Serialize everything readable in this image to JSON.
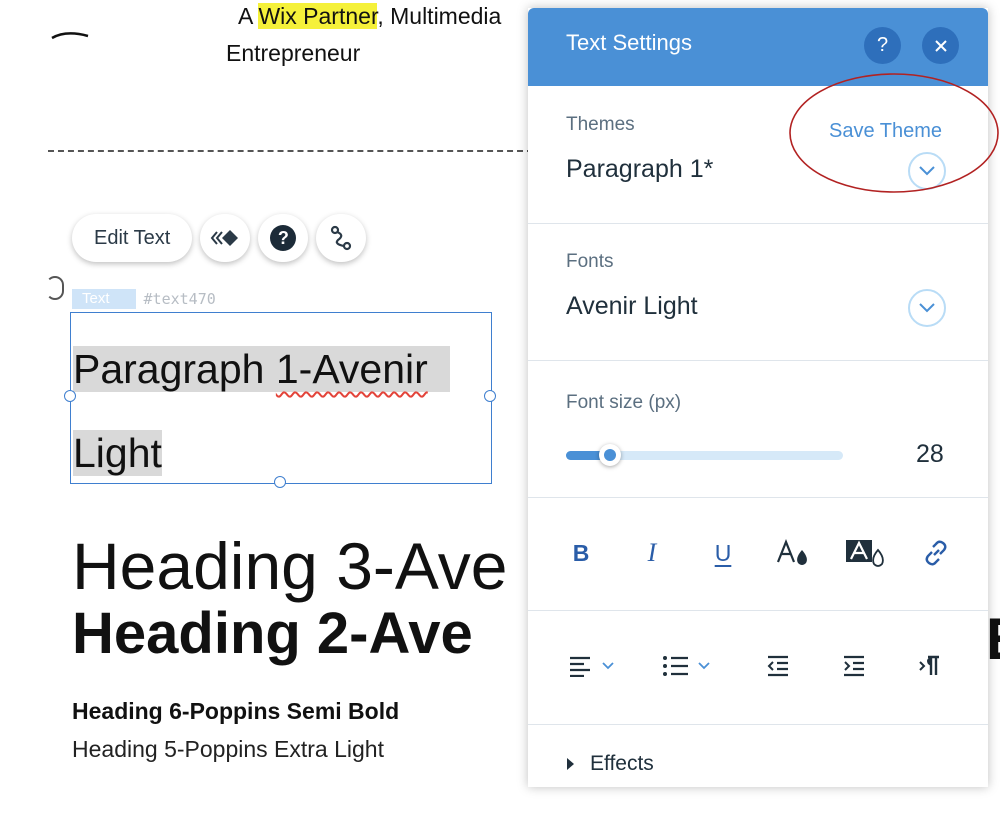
{
  "canvas": {
    "tagline_prefix": "A ",
    "tagline_highlight": "Wix Partner",
    "tagline_suffix": ", Multimedia",
    "subtitle": "Entrepreneur",
    "toolbar": {
      "edit_text_label": "Edit Text"
    },
    "component_tag": {
      "type": "Text",
      "id": "#text470"
    },
    "selected_text": {
      "line1_a": "Paragraph ",
      "line1_b": "1-Avenir",
      "line2": "Light"
    },
    "heading3": "Heading 3-Ave",
    "heading2": "Heading 2-Ave",
    "heading2_right_fragment": "E",
    "heading6": "Heading 6-Poppins Semi Bold",
    "heading5": "Heading 5-Poppins Extra Light"
  },
  "panel": {
    "title": "Text Settings",
    "help_icon": "question-icon",
    "close_icon": "close-icon",
    "themes": {
      "label": "Themes",
      "value": "Paragraph 1*",
      "save_link": "Save Theme"
    },
    "fonts": {
      "label": "Fonts",
      "value": "Avenir Light"
    },
    "font_size": {
      "label": "Font size (px)",
      "value": "28",
      "fraction": 0.16
    },
    "format_icons": [
      "bold-icon",
      "italic-icon",
      "underline-icon",
      "text-color-icon",
      "highlight-color-icon",
      "link-icon"
    ],
    "format_labels": {
      "bold": "B",
      "italic": "I",
      "underline": "U"
    },
    "alignment_icons": [
      "align-left-icon",
      "bullet-list-icon",
      "decrease-indent-icon",
      "increase-indent-icon",
      "text-direction-icon"
    ],
    "effects_label": "Effects"
  },
  "colors": {
    "accent": "#4a90d6",
    "header_button": "#2e6fbb",
    "highlight": "#f5f13a",
    "annotation": "#b22222"
  }
}
